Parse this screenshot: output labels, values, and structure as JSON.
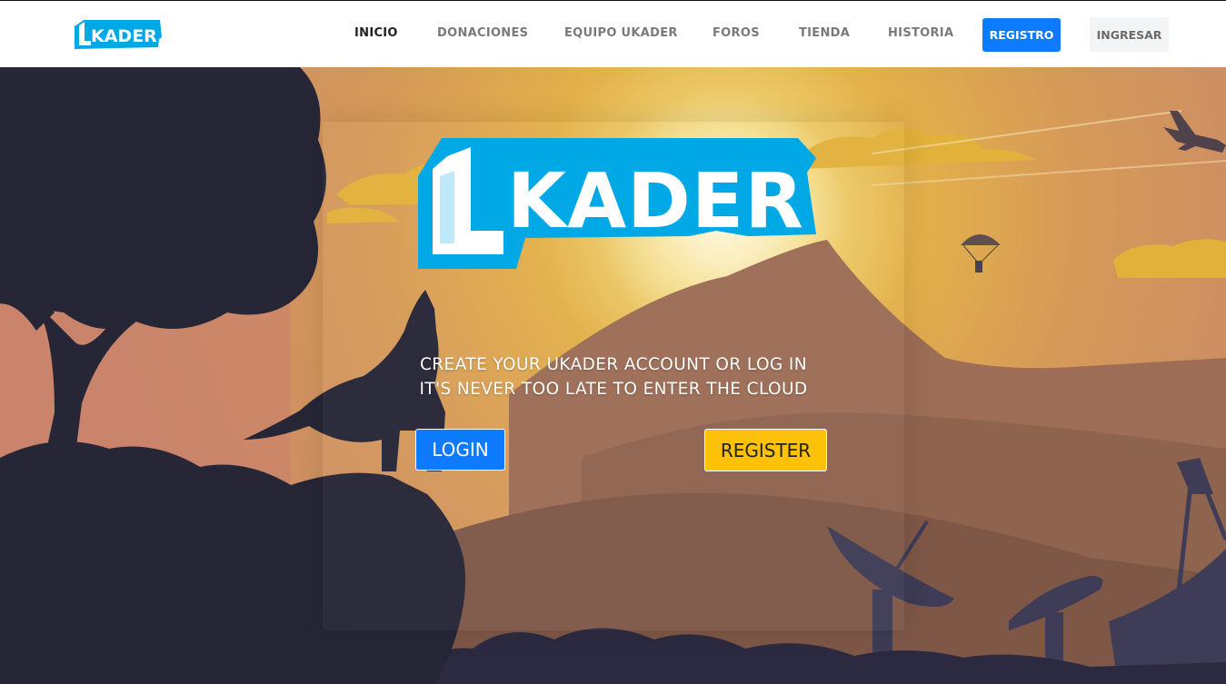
{
  "brand": {
    "name": "UKADER",
    "logo_letter": "U",
    "logo_rest": "KADER"
  },
  "nav": {
    "items": [
      {
        "label": "INICIO",
        "active": true
      },
      {
        "label": "DONACIONES",
        "active": false
      },
      {
        "label": "EQUIPO UKADER",
        "active": false
      },
      {
        "label": "FOROS",
        "active": false
      },
      {
        "label": "TIENDA",
        "active": false
      },
      {
        "label": "HISTORIA",
        "active": false
      }
    ],
    "registro_label": "REGISTRO",
    "ingresar_label": "INGRESAR"
  },
  "hero": {
    "line1": "CREATE YOUR UKADER ACCOUNT OR LOG IN",
    "line2": "IT'S NEVER TOO LATE TO ENTER THE CLOUD",
    "login_label": "LOGIN",
    "register_label": "REGISTER"
  },
  "colors": {
    "accent_blue": "#0d7aff",
    "logo_blue": "#00a8e6",
    "register_yellow": "#fdc107",
    "silhouette": "#262637"
  }
}
